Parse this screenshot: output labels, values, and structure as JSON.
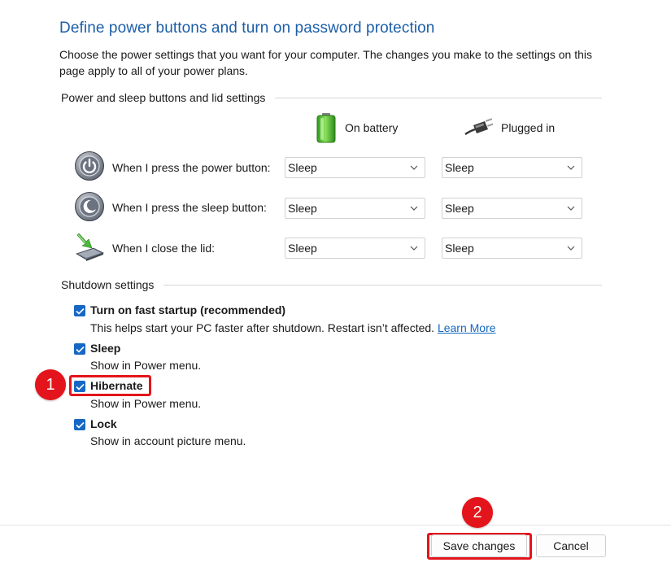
{
  "page": {
    "title": "Define power buttons and turn on password protection",
    "intro": "Choose the power settings that you want for your computer. The changes you make to the settings on this page apply to all of your power plans."
  },
  "power_section": {
    "label": "Power and sleep buttons and lid settings",
    "columns": {
      "battery": {
        "label": "On battery",
        "icon": "battery-icon"
      },
      "plugged": {
        "label": "Plugged in",
        "icon": "power-plug-icon"
      }
    },
    "rows": [
      {
        "label": "When I press the power button:",
        "icon": "power-button-icon",
        "battery": "Sleep",
        "plugged": "Sleep"
      },
      {
        "label": "When I press the sleep button:",
        "icon": "sleep-button-icon",
        "battery": "Sleep",
        "plugged": "Sleep"
      },
      {
        "label": "When I close the lid:",
        "icon": "laptop-lid-icon",
        "battery": "Sleep",
        "plugged": "Sleep"
      }
    ]
  },
  "shutdown_section": {
    "label": "Shutdown settings",
    "options": [
      {
        "title": "Turn on fast startup (recommended)",
        "desc": "This helps start your PC faster after shutdown. Restart isn’t affected.",
        "link": "Learn More",
        "checked": true
      },
      {
        "title": "Sleep",
        "desc": "Show in Power menu.",
        "checked": true
      },
      {
        "title": "Hibernate",
        "desc": "Show in Power menu.",
        "checked": true
      },
      {
        "title": "Lock",
        "desc": "Show in account picture menu.",
        "checked": true
      }
    ]
  },
  "annotations": {
    "step1": "1",
    "step2": "2",
    "color": "#e3141b"
  },
  "footer": {
    "save_label": "Save changes",
    "cancel_label": "Cancel"
  },
  "colors": {
    "title": "#1c5ea8",
    "checkbox": "#1668c4",
    "link": "#1467c0"
  }
}
